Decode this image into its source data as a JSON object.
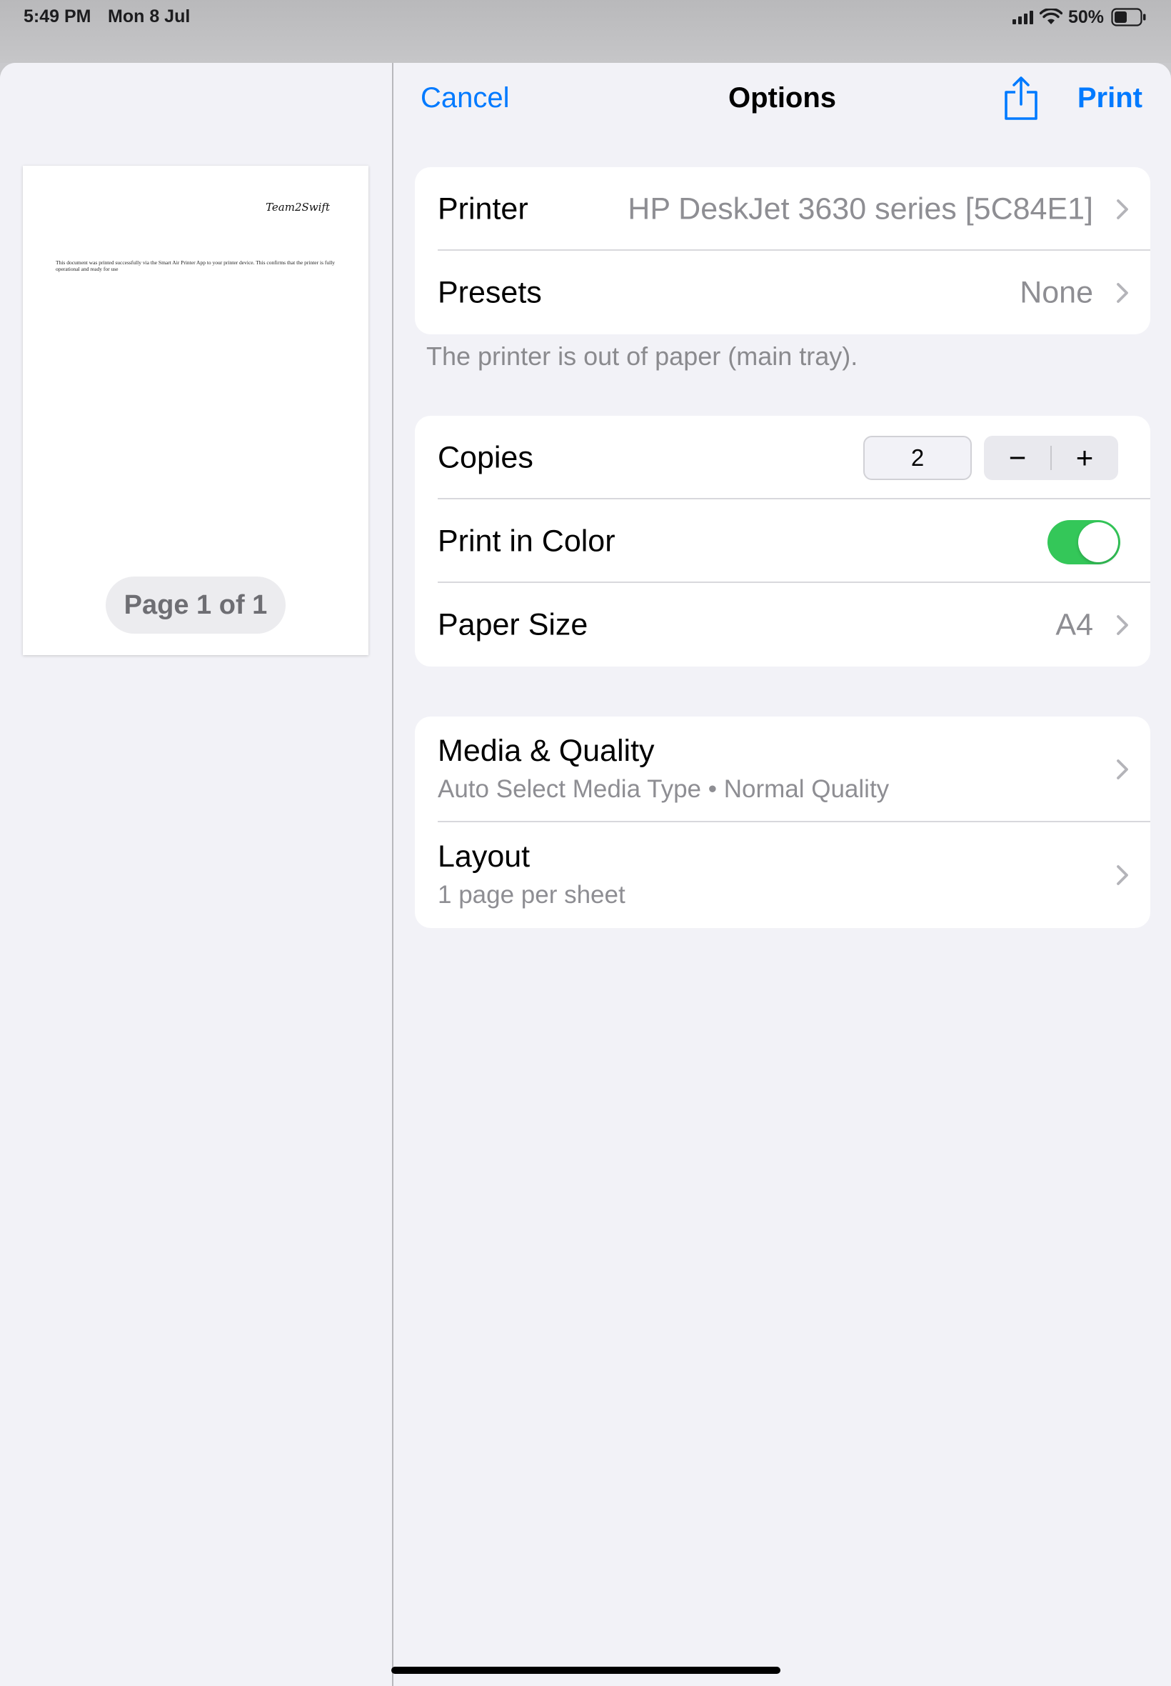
{
  "status_bar": {
    "time": "5:49 PM",
    "date": "Mon 8 Jul",
    "battery": "50%"
  },
  "preview": {
    "logo": "Team2Swift",
    "body_text": "This document was printed successfully via the Smart Air Printer App to your printer device. This confirms that the printer is fully operational and ready for use",
    "page_indicator": "Page 1 of 1"
  },
  "nav": {
    "cancel": "Cancel",
    "title": "Options",
    "print": "Print"
  },
  "printer_group": {
    "printer_label": "Printer",
    "printer_value": "HP DeskJet 3630 series [5C84E1]",
    "presets_label": "Presets",
    "presets_value": "None"
  },
  "status_note": "The printer is out of paper (main tray).",
  "settings_group": {
    "copies_label": "Copies",
    "copies_value": "2",
    "decrement": "−",
    "increment": "+",
    "color_label": "Print in Color",
    "color_on": true,
    "paper_label": "Paper Size",
    "paper_value": "A4"
  },
  "more_group": {
    "media_label": "Media & Quality",
    "media_sub": "Auto Select Media Type • Normal Quality",
    "layout_label": "Layout",
    "layout_sub": "1 page per sheet"
  },
  "colors": {
    "accent": "#007aff",
    "toggle_on": "#34c759",
    "secondary_text": "#8e8e93",
    "background": "#f2f2f7"
  },
  "icons": [
    "signal-icon",
    "wifi-icon",
    "battery-icon",
    "share-icon",
    "chevron-right-icon"
  ]
}
